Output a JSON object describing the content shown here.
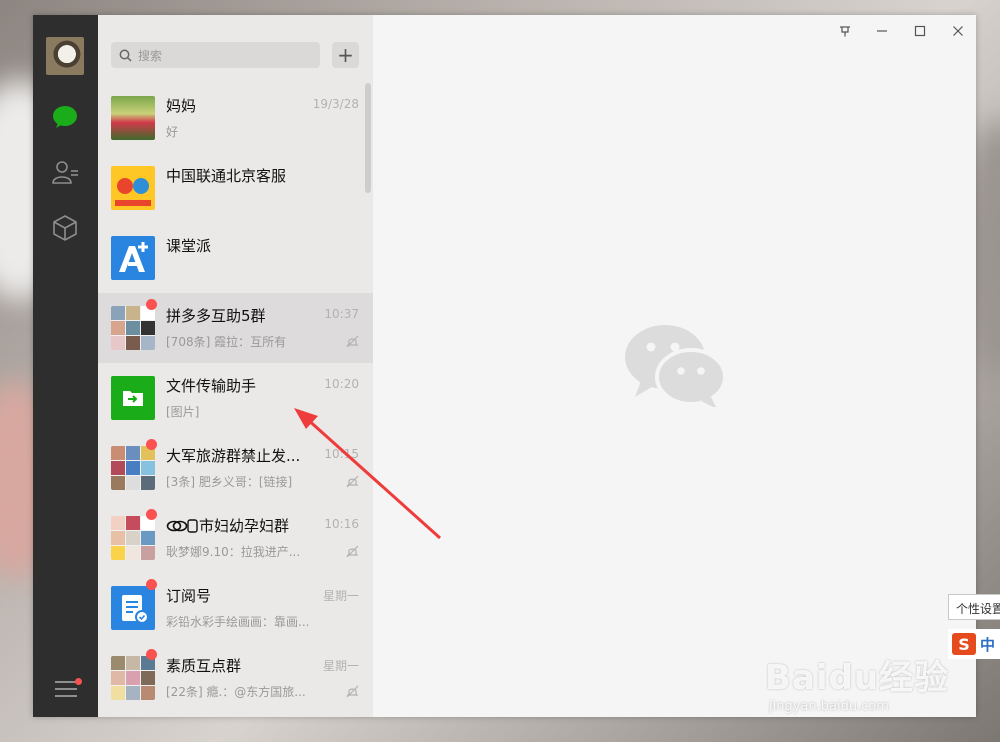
{
  "search": {
    "placeholder": "搜索",
    "add_label": "+"
  },
  "chats": [
    {
      "title": "妈妈",
      "time": "19/3/28",
      "preview": "好",
      "unread": false,
      "muted": false
    },
    {
      "title": "中国联通北京客服",
      "time": "",
      "preview": "",
      "unread": false,
      "muted": false
    },
    {
      "title": "课堂派",
      "time": "",
      "preview": "",
      "unread": false,
      "muted": false
    },
    {
      "title": "拼多多互助5群",
      "time": "10:37",
      "preview": "[708条] 霞拉：互所有",
      "unread": true,
      "muted": true
    },
    {
      "title": "文件传输助手",
      "time": "10:20",
      "preview": "[图片]",
      "unread": false,
      "muted": false
    },
    {
      "title": "大军旅游群禁止发...",
      "time": "10:15",
      "preview": "[3条] 肥乡义哥：[链接]",
      "unread": true,
      "muted": true
    },
    {
      "title": "市妇幼孕妇群",
      "time": "10:16",
      "preview": "耿梦娜9.10：拉我进产...",
      "unread": true,
      "muted": true
    },
    {
      "title": "订阅号",
      "time": "星期一",
      "preview": "彩铅水彩手绘画画：靠画...",
      "unread": true,
      "muted": false
    },
    {
      "title": "素质互点群",
      "time": "星期一",
      "preview": "[22条] 瘾.：@东方国旅...",
      "unread": true,
      "muted": true
    }
  ],
  "overlay": {
    "tooltip": "个性设置",
    "ime_logo_letter": "S",
    "ime_label": "中",
    "watermark_main": "Baidu经验",
    "watermark_sub": "jingyan.baidu.com"
  },
  "colors": {
    "accent": "#1aad19",
    "unread": "#fa5151",
    "nav_bg": "#2e2e2e"
  }
}
